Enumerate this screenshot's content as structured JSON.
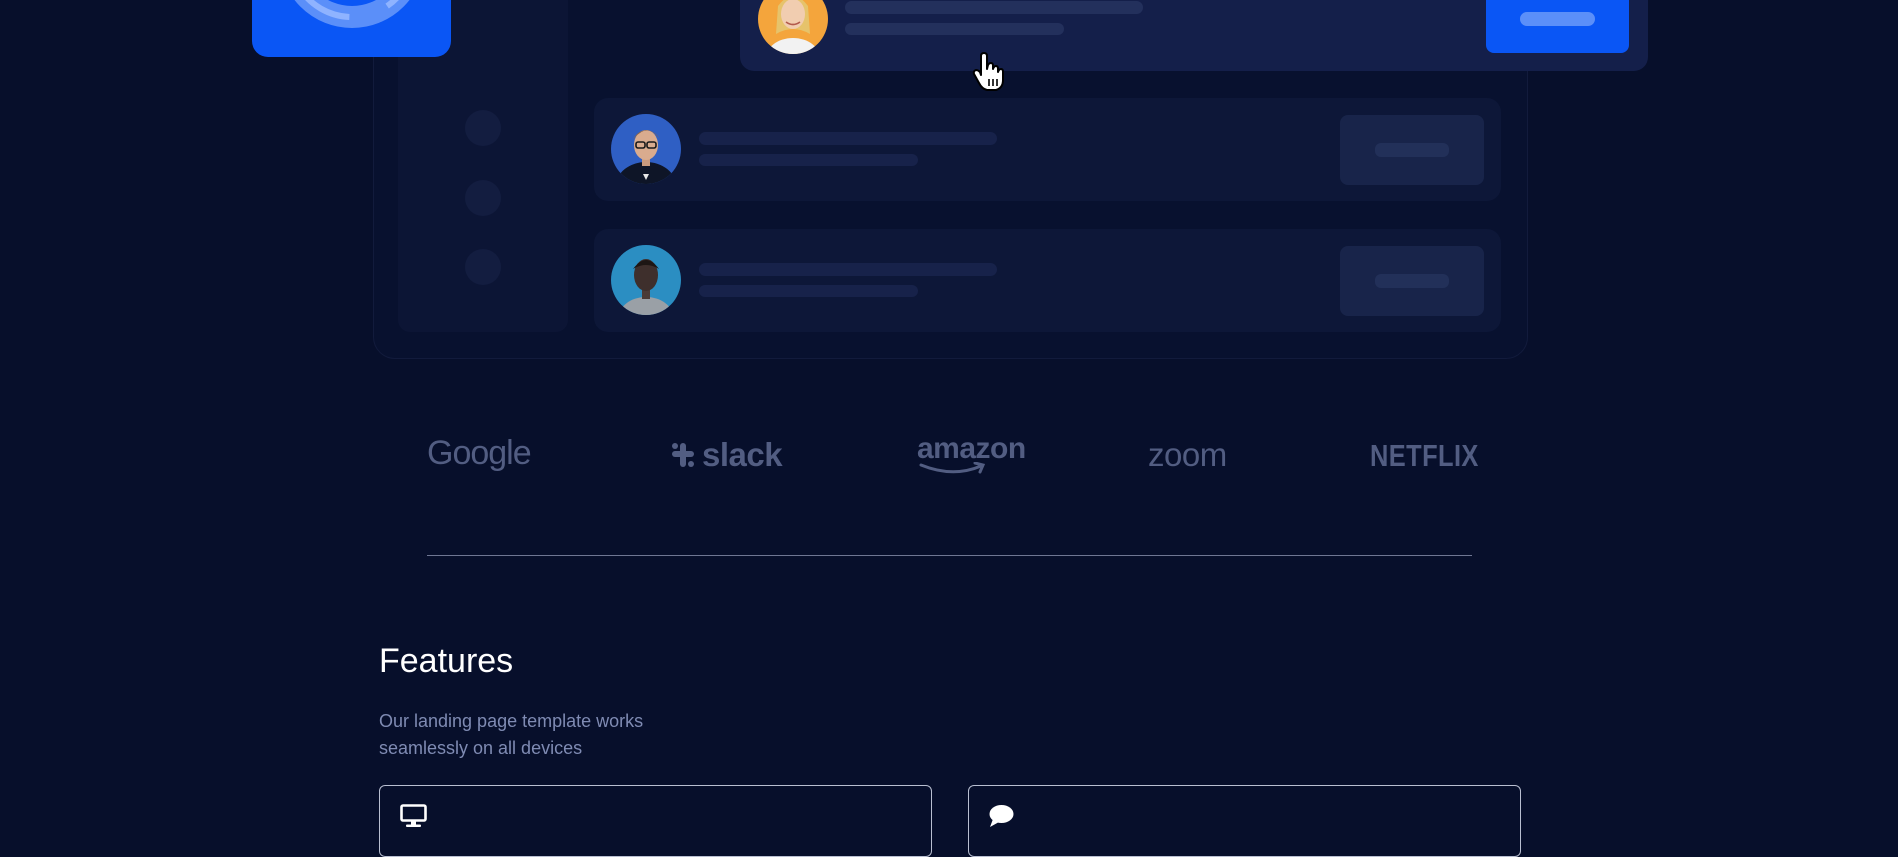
{
  "brands": {
    "google": "Google",
    "slack": "slack",
    "amazon": "amazon",
    "zoom": "zoom",
    "netflix": "NETFLIX"
  },
  "features": {
    "title": "Features",
    "subtitle_line1": "Our landing page template works",
    "subtitle_line2": "seamlessly on all devices",
    "cards": [
      {
        "icon": "monitor-icon"
      },
      {
        "icon": "chat-bubble-icon"
      }
    ]
  },
  "colors": {
    "background": "#070f2b",
    "accent": "#0a56f5",
    "brand_logo": "#525d82",
    "muted_text": "#7f8bb3"
  }
}
